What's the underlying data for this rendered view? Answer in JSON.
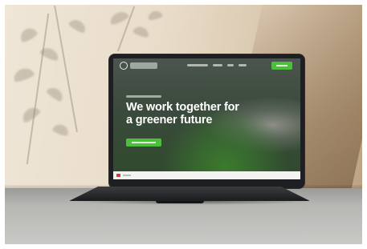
{
  "scene": {
    "description_hidden": "",
    "colors": {
      "accent_green": "#4cbf3c",
      "wall": "#e9ddca",
      "table": "#b6b6b3",
      "laptop": "#1d1f22"
    }
  },
  "website": {
    "hero_title_line1": "We work together for",
    "hero_title_line2": "a greener future"
  }
}
